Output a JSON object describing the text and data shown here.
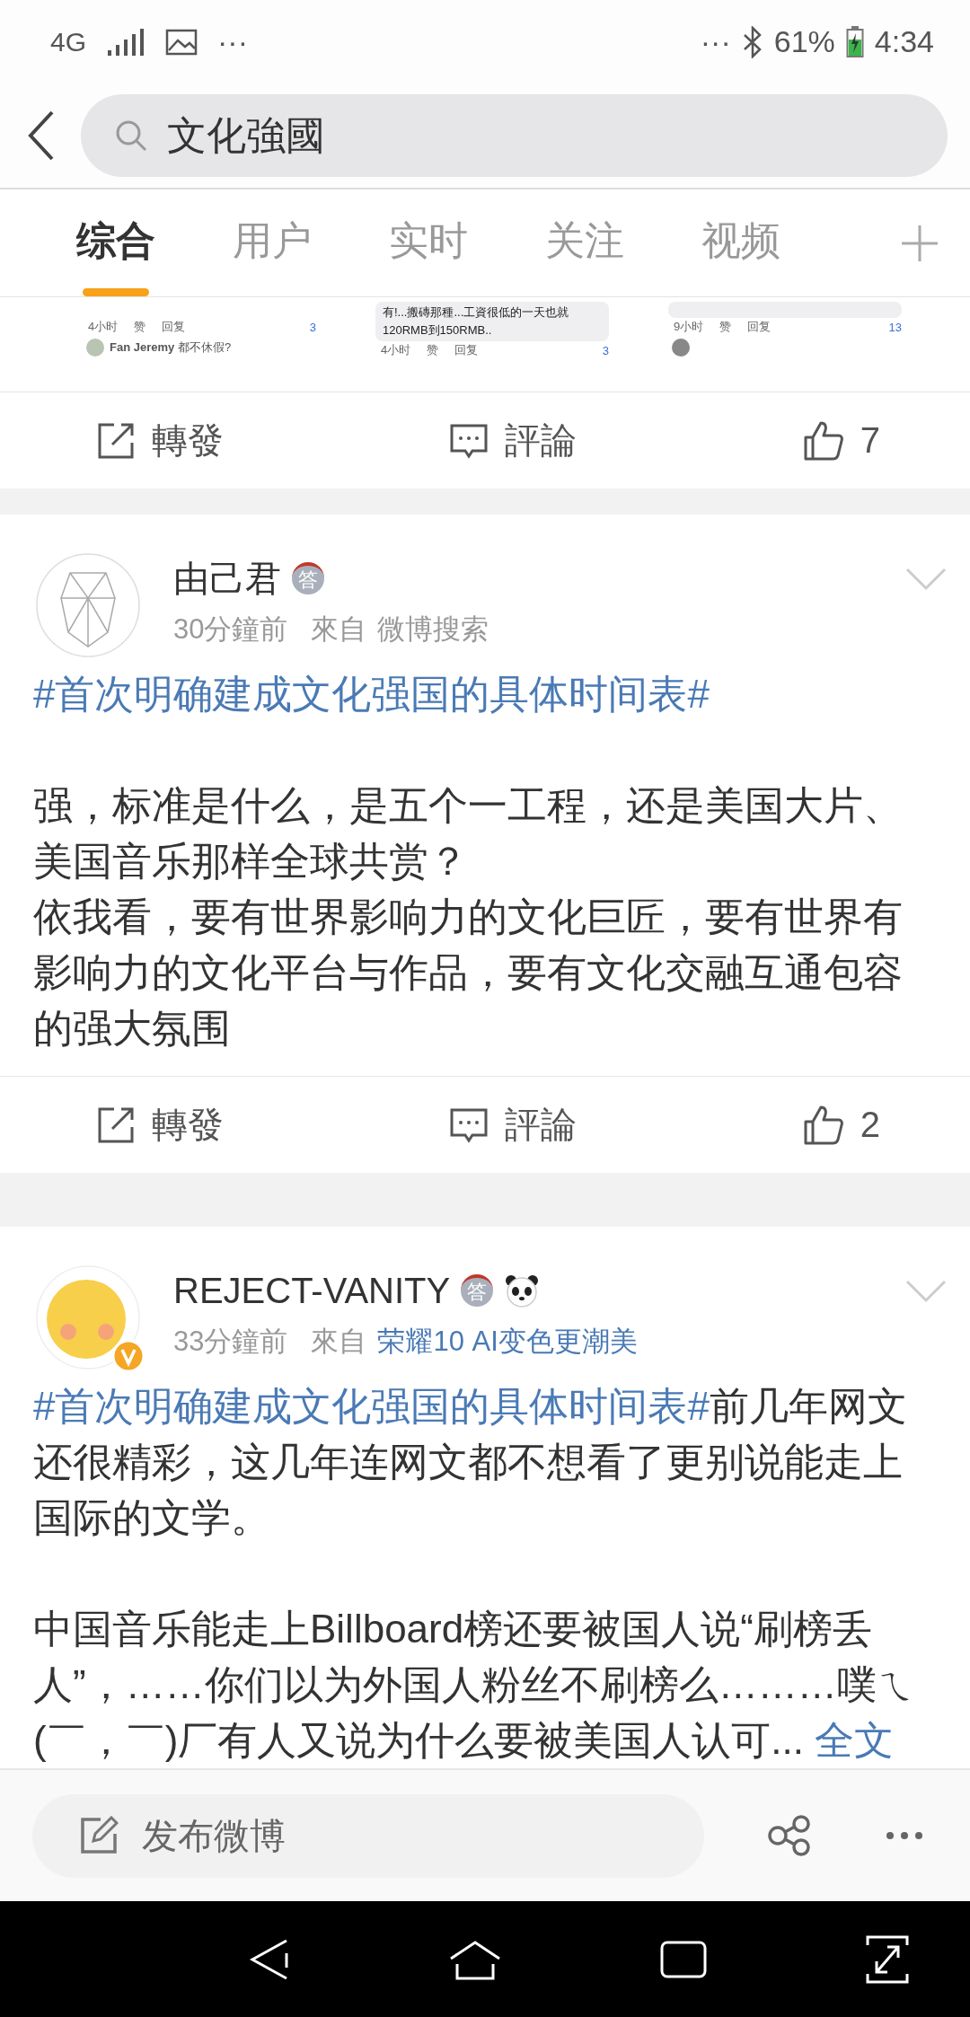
{
  "status_bar": {
    "network": "4G",
    "left_more": "···",
    "right_more": "···",
    "battery": "61%",
    "time": "4:34"
  },
  "search": {
    "value": "文化強國"
  },
  "tabs": [
    {
      "label": "综合",
      "selected": true
    },
    {
      "label": "用户",
      "selected": false
    },
    {
      "label": "实时",
      "selected": false
    },
    {
      "label": "关注",
      "selected": false
    },
    {
      "label": "视频",
      "selected": false
    }
  ],
  "preview_tiles": [
    {
      "items": [
        {
          "kind": "meta",
          "time": "4小时",
          "like": "赞",
          "reply": "回复",
          "reactions": "3"
        },
        {
          "kind": "comment",
          "text": "**Fan Jeremy** 都不休假?"
        }
      ]
    },
    {
      "items": [
        {
          "kind": "bubble",
          "lines": [
            "有!...搬磚那種...工資很低的一天也就",
            "120RMB到150RMB.."
          ]
        },
        {
          "kind": "meta",
          "time": "4小时",
          "like": "赞",
          "reply": "回复",
          "reactions": "3"
        }
      ]
    },
    {
      "items": [
        {
          "kind": "bubble"
        },
        {
          "kind": "meta",
          "time": "9小时",
          "like": "赞",
          "reply": "回复",
          "reactions": "13"
        },
        {
          "kind": "avatar_row"
        }
      ]
    }
  ],
  "preview_actions": {
    "repost": "轉發",
    "comment": "評論",
    "likes": "7"
  },
  "posts": [
    {
      "verified": false,
      "author": "由己君",
      "badges": [
        {
          "kind": "medal",
          "text": "答"
        }
      ],
      "time": "30分鐘前",
      "source_prefix": "來自",
      "source": "微博搜索",
      "source_link": false,
      "paragraphs": [
        {
          "kind": "para",
          "segments": [
            {
              "kind": "hashtag",
              "text": "#首次明确建成文化强国的具体时间表#"
            }
          ]
        },
        {
          "kind": "blank"
        },
        {
          "kind": "para",
          "segments": [
            {
              "kind": "text",
              "text": "强，标准是什么，是五个一工程，还是美国大片、美国音乐那样全球共赏？"
            }
          ]
        },
        {
          "kind": "para",
          "segments": [
            {
              "kind": "text",
              "text": "依我看，要有世界影响力的文化巨匠，要有世界有影响力的文化平台与作品，要有文化交融互通包容的强大氛围"
            }
          ]
        }
      ],
      "actions": {
        "repost": "轉發",
        "comment": "評論",
        "likes": "2"
      }
    },
    {
      "verified": true,
      "author": "REJECT-VANITY",
      "badges": [
        {
          "kind": "medal",
          "text": "答"
        },
        {
          "kind": "panda"
        }
      ],
      "time": "33分鐘前",
      "source_prefix": "來自",
      "source": "荣耀10 AI变色更潮美",
      "source_link": true,
      "paragraphs": [
        {
          "kind": "para",
          "segments": [
            {
              "kind": "hashtag",
              "text": "#首次明确建成文化强国的具体时间表#"
            },
            {
              "kind": "text",
              "text": "前几年网文还很精彩，这几年连网文都不想看了更别说能走上国际的文学。"
            }
          ]
        },
        {
          "kind": "blank"
        },
        {
          "kind": "para",
          "segments": [
            {
              "kind": "text",
              "text": "中国音乐能走上Billboard榜还要被国人说“刷榜丢人”，……你们以为外国人粉丝不刷榜么………噗ㄟ(￣，￣)厂有人又说为什么要被美国人认可... "
            },
            {
              "kind": "more",
              "text": "全文"
            }
          ]
        }
      ]
    }
  ],
  "composer": {
    "placeholder": "发布微博"
  }
}
